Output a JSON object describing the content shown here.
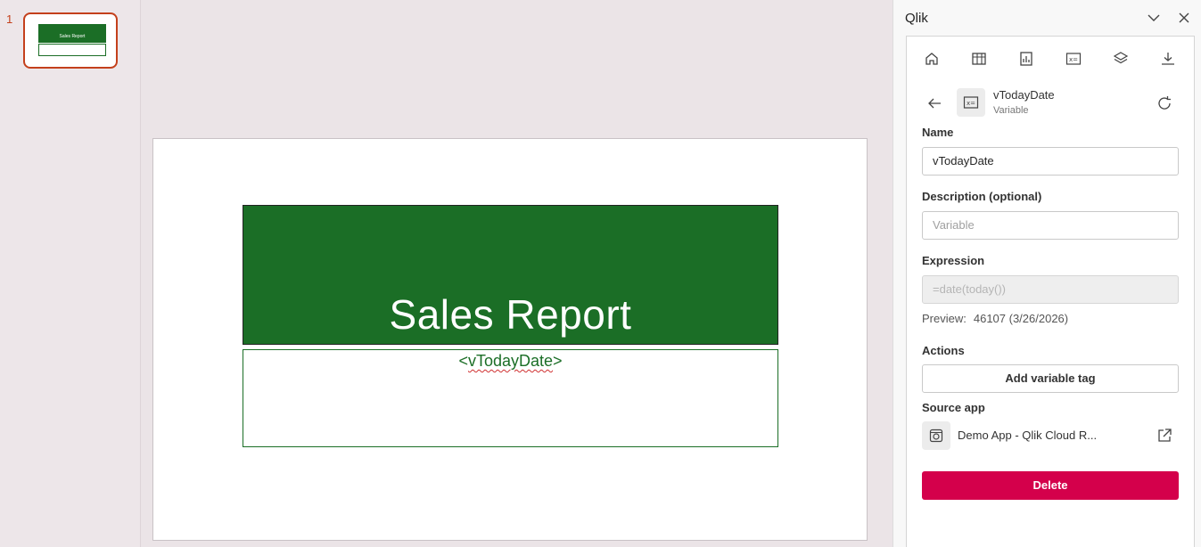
{
  "thumbnails": [
    {
      "number": "1",
      "title": "Sales Report"
    }
  ],
  "slide": {
    "title": "Sales Report",
    "date_placeholder_prefix": "<",
    "date_placeholder_var": "vTodayDate",
    "date_placeholder_suffix": ">",
    "accent": "#1b6e26"
  },
  "panel": {
    "title": "Qlik",
    "toolbar": [
      "home-icon",
      "table-icon",
      "chart-icon",
      "variable-icon",
      "layers-icon",
      "download-icon"
    ],
    "variable": {
      "name": "vTodayDate",
      "type": "Variable"
    },
    "name_label": "Name",
    "name_value": "vTodayDate",
    "description_label": "Description (optional)",
    "description_placeholder": "Variable",
    "expression_label": "Expression",
    "expression_value": "=date(today())",
    "preview_label": "Preview:",
    "preview_value": "46107 (3/26/2026)",
    "actions_label": "Actions",
    "add_tag_label": "Add variable tag",
    "source_label": "Source app",
    "source_name": "Demo App - Qlik Cloud R...",
    "delete_label": "Delete",
    "delete_color": "#d4004b"
  }
}
